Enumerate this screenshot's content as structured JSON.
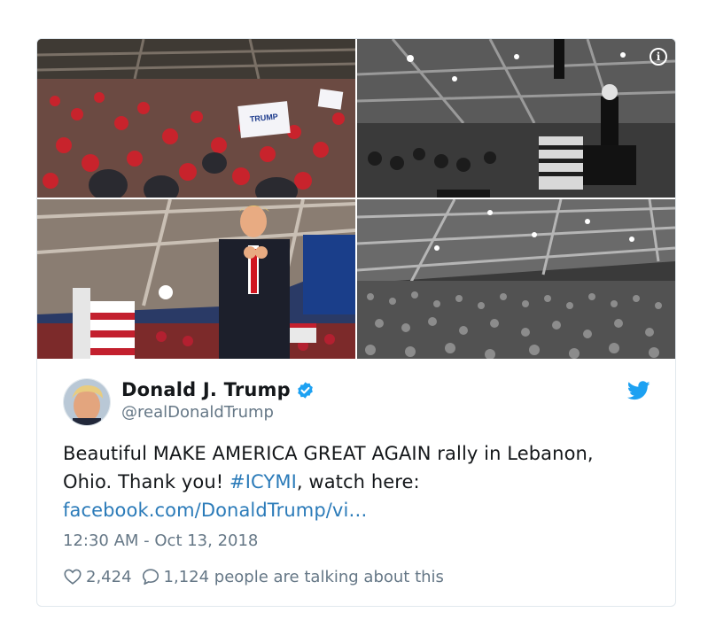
{
  "tweet": {
    "display_name": "Donald J. Trump",
    "handle": "@realDonaldTrump",
    "text_part1": "Beautiful MAKE AMERICA GREAT AGAIN rally in Lebanon, Ohio. Thank you! ",
    "hashtag": "#ICYMI",
    "text_part2": ", watch here: ",
    "link": "facebook.com/DonaldTrump/vi…",
    "timestamp": "12:30 AM - Oct 13, 2018",
    "likes": "2,424",
    "talking": "1,124 people are talking about this"
  },
  "media": {
    "sign_text": "TRUMP",
    "info_glyph": "i"
  },
  "colors": {
    "link": "#2b7bb9",
    "twitter_blue": "#1da1f2",
    "muted": "#657786",
    "text": "#14171a"
  },
  "icons": [
    "info-icon",
    "verified-badge-icon",
    "twitter-bird-icon",
    "heart-icon",
    "comment-bubble-icon"
  ]
}
